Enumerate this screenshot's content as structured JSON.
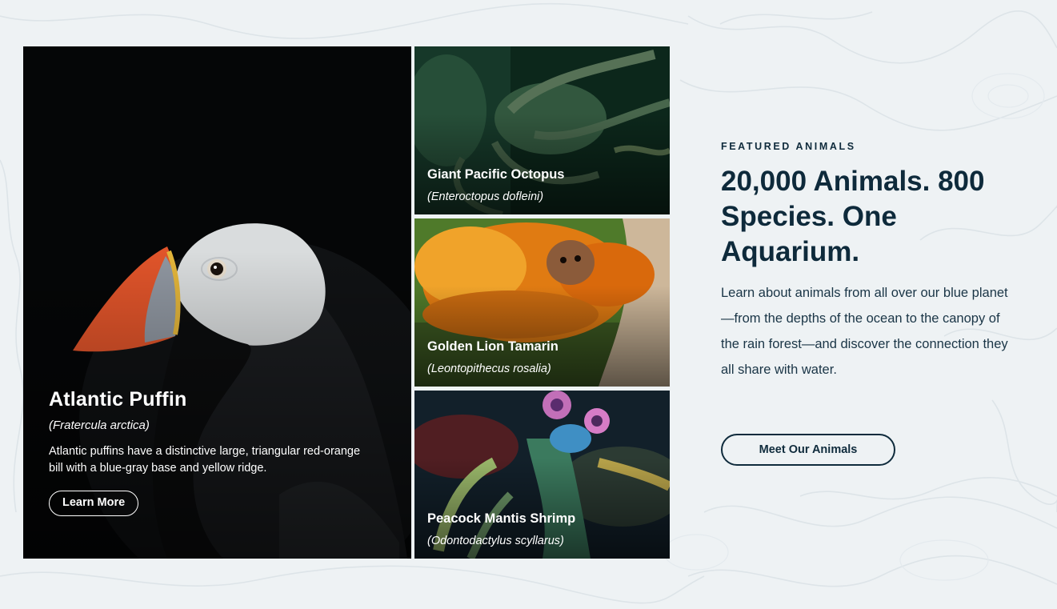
{
  "featured": {
    "label": "FEATURED ANIMALS",
    "headline": "20,000 Animals. 800 Species. One Aquarium.",
    "body": "Learn about animals from all over our blue planet—from the depths of the ocean to the canopy of the rain forest—and discover the connection they all share with water.",
    "cta": "Meet Our Animals"
  },
  "cards": [
    {
      "name": "Atlantic Puffin",
      "scientific": "(Fratercula arctica)",
      "description": "Atlantic puffins have a distinctive large, triangular red-orange bill with a blue-gray base and yellow ridge.",
      "button": "Learn More"
    },
    {
      "name": "Giant Pacific Octopus",
      "scientific": "(Enteroctopus dofleini)"
    },
    {
      "name": "Golden Lion Tamarin",
      "scientific": "(Leontopithecus rosalia)"
    },
    {
      "name": "Peacock Mantis Shrimp",
      "scientific": "(Odontodactylus scyllarus)"
    }
  ],
  "colors": {
    "background": "#eef2f4",
    "navy": "#0f2b3c",
    "card_text": "#ffffff"
  }
}
